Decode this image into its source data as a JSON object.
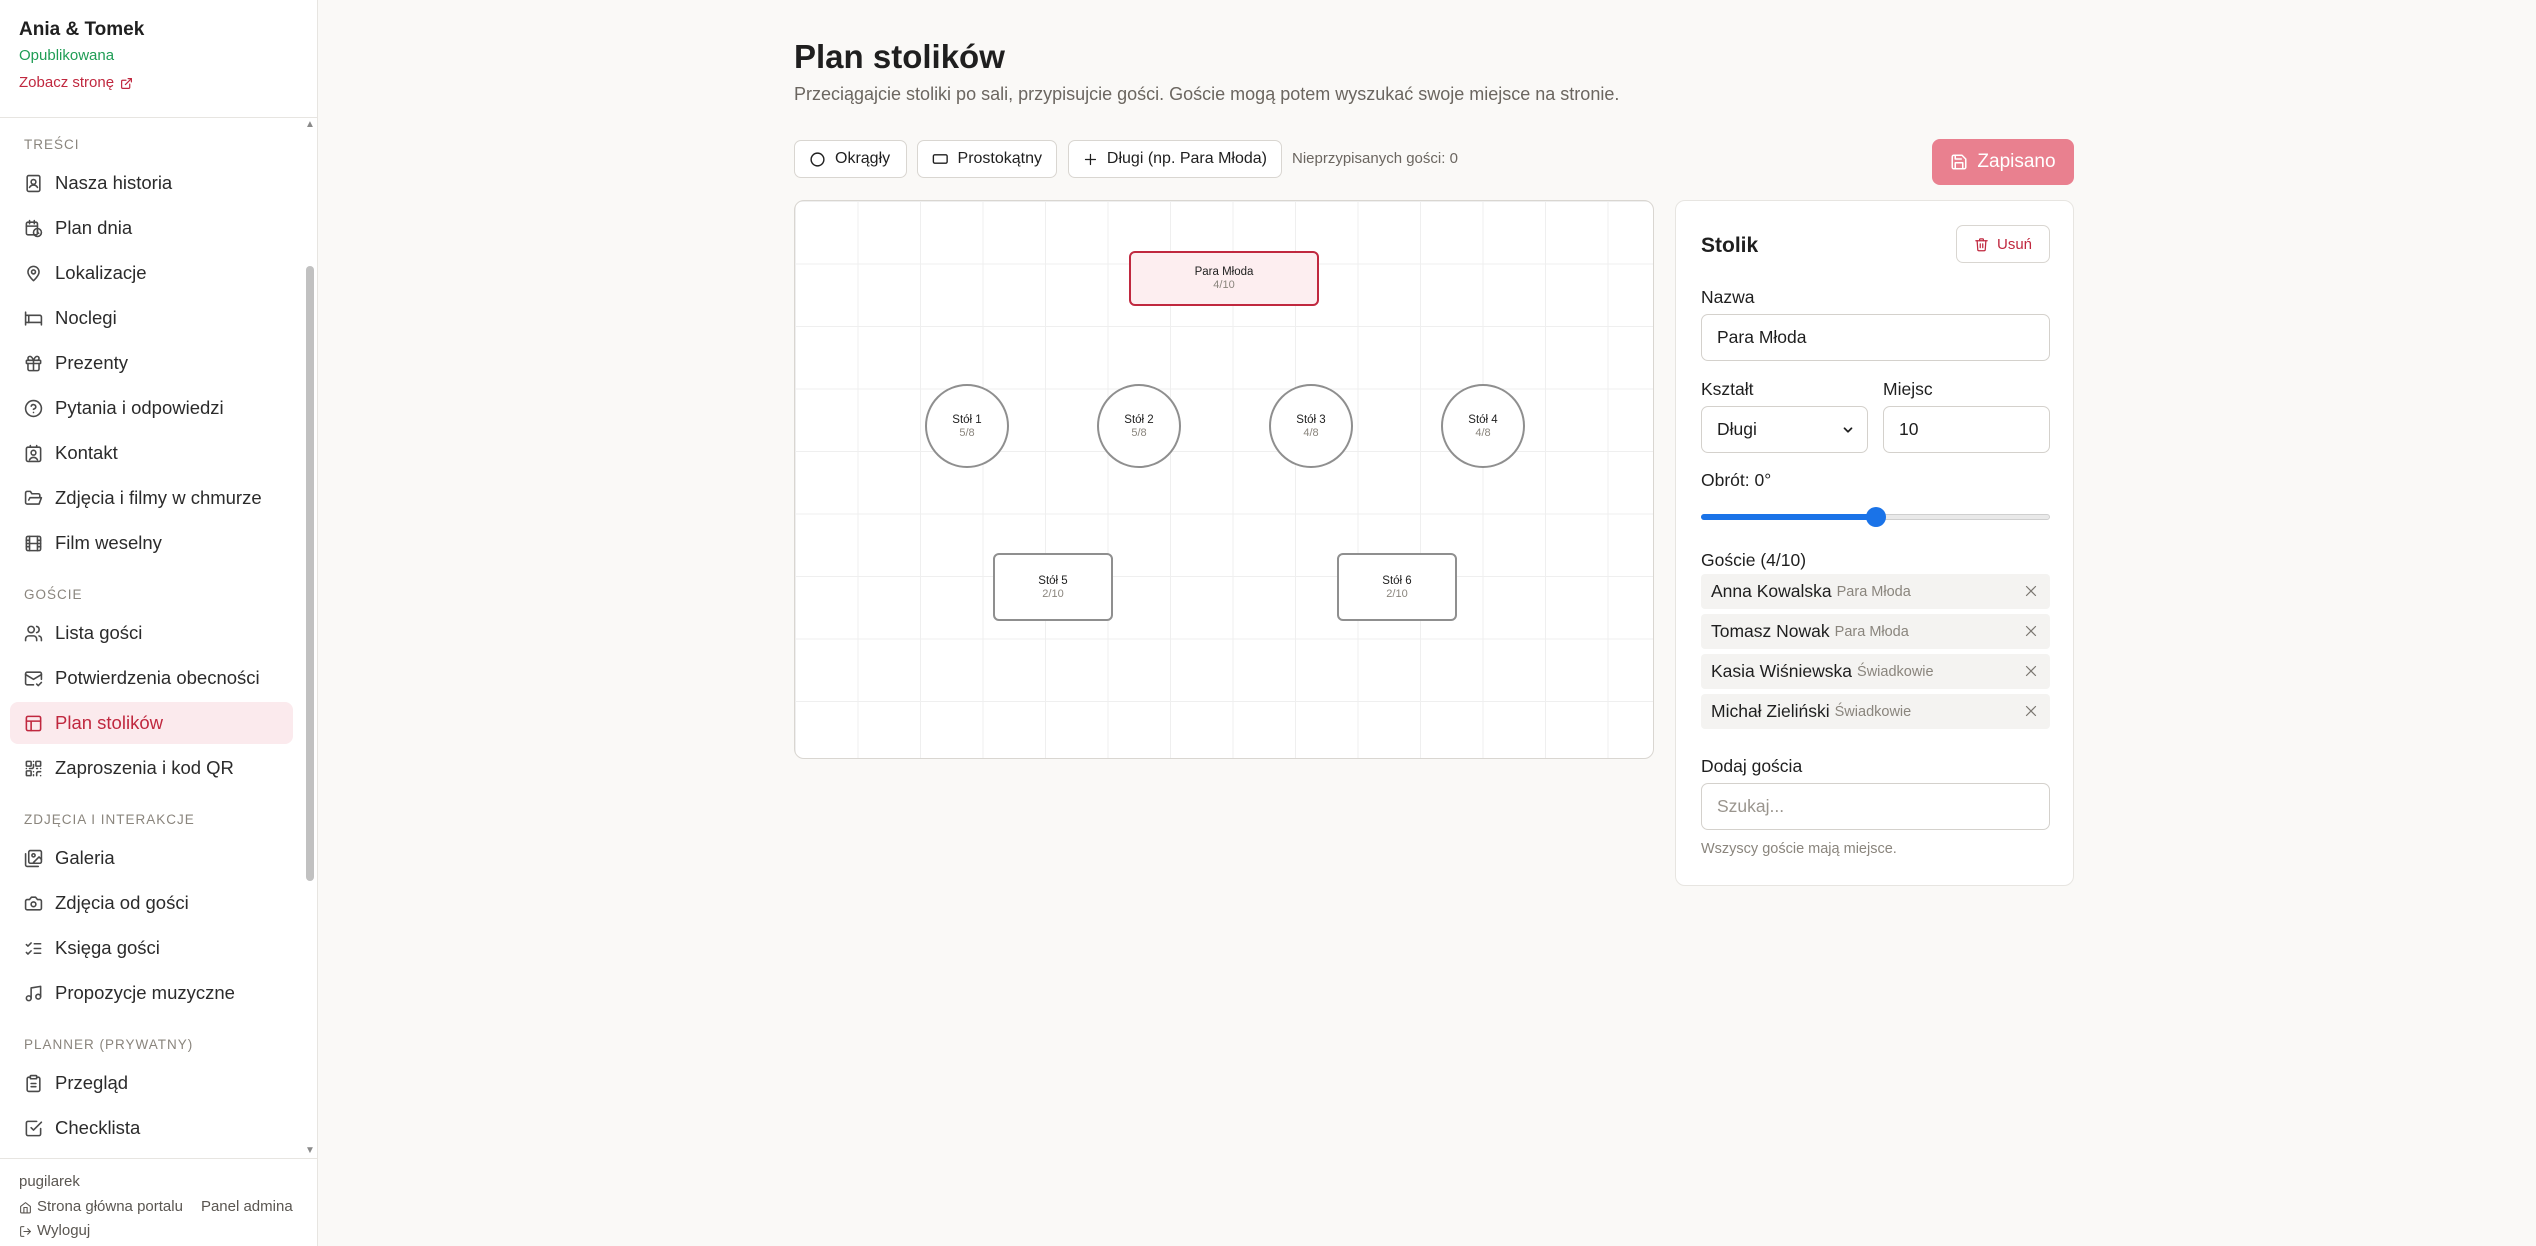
{
  "sidebar": {
    "couple": "Ania & Tomek",
    "status": "Opublikowana",
    "view_link": "Zobacz stronę",
    "sections": [
      {
        "title": "TREŚCI",
        "items": [
          {
            "label": "Nasza historia",
            "icon": "book-user-icon"
          },
          {
            "label": "Plan dnia",
            "icon": "calendar-clock-icon"
          },
          {
            "label": "Lokalizacje",
            "icon": "map-pin-icon"
          },
          {
            "label": "Noclegi",
            "icon": "bed-icon"
          },
          {
            "label": "Prezenty",
            "icon": "gift-icon"
          },
          {
            "label": "Pytania i odpowiedzi",
            "icon": "help-circle-icon"
          },
          {
            "label": "Kontakt",
            "icon": "contact-icon"
          },
          {
            "label": "Zdjęcia i filmy w chmurze",
            "icon": "folder-open-icon"
          },
          {
            "label": "Film weselny",
            "icon": "film-icon"
          }
        ]
      },
      {
        "title": "GOŚCIE",
        "items": [
          {
            "label": "Lista gości",
            "icon": "users-icon"
          },
          {
            "label": "Potwierdzenia obecności",
            "icon": "mail-check-icon"
          },
          {
            "label": "Plan stolików",
            "icon": "layout-grid-icon"
          },
          {
            "label": "Zaproszenia i kod QR",
            "icon": "qr-code-icon"
          }
        ]
      },
      {
        "title": "ZDJĘCIA I INTERAKCJE",
        "items": [
          {
            "label": "Galeria",
            "icon": "images-icon"
          },
          {
            "label": "Zdjęcia od gości",
            "icon": "camera-icon"
          },
          {
            "label": "Księga gości",
            "icon": "list-checks-icon"
          },
          {
            "label": "Propozycje muzyczne",
            "icon": "music-icon"
          }
        ]
      },
      {
        "title": "PLANNER (PRYWATNY)",
        "items": [
          {
            "label": "Przegląd",
            "icon": "clipboard-icon"
          },
          {
            "label": "Checklista",
            "icon": "check-square-icon"
          }
        ]
      }
    ],
    "active_item": "Plan stolików",
    "footer": {
      "user": "pugilarek",
      "home_link": "Strona główna portalu",
      "admin_link": "Panel admina",
      "logout": "Wyloguj"
    }
  },
  "page": {
    "title": "Plan stolików",
    "subtitle": "Przeciągajcie stoliki po sali, przypisujcie gości. Goście mogą potem wyszukać swoje miejsce na stronie."
  },
  "toolbar": {
    "round_label": "Okrągły",
    "rect_label": "Prostokątny",
    "long_label": "Długi (np. Para Młoda)",
    "unassigned": "Nieprzypisanych gości: 0",
    "save_label": "Zapisano"
  },
  "tables": [
    {
      "name": "Para Młoda",
      "count": "4/10",
      "shape": "long",
      "selected": true
    },
    {
      "name": "Stół 1",
      "count": "5/8",
      "shape": "round"
    },
    {
      "name": "Stół 2",
      "count": "5/8",
      "shape": "round"
    },
    {
      "name": "Stół 3",
      "count": "4/8",
      "shape": "round"
    },
    {
      "name": "Stół 4",
      "count": "4/8",
      "shape": "round"
    },
    {
      "name": "Stół 5",
      "count": "2/10",
      "shape": "rect"
    },
    {
      "name": "Stół 6",
      "count": "2/10",
      "shape": "rect"
    }
  ],
  "panel": {
    "title": "Stolik",
    "delete_label": "Usuń",
    "name_label": "Nazwa",
    "name_value": "Para Młoda",
    "shape_label": "Kształt",
    "shape_value": "Długi",
    "seats_label": "Miejsc",
    "seats_value": "10",
    "rotation_label": "Obrót: 0°",
    "rotation_fraction": 0.5,
    "guests_label": "Goście (4/10)",
    "guests": [
      {
        "name": "Anna Kowalska",
        "group": "Para Młoda"
      },
      {
        "name": "Tomasz Nowak",
        "group": "Para Młoda"
      },
      {
        "name": "Kasia Wiśniewska",
        "group": "Świadkowie"
      },
      {
        "name": "Michał Zieliński",
        "group": "Świadkowie"
      }
    ],
    "add_guest_label": "Dodaj gościa",
    "search_placeholder": "Szukaj...",
    "note": "Wszyscy goście mają miejsce."
  },
  "colors": {
    "accent": "#c0283f",
    "published": "#1f9d55",
    "save_button": "#e9808f",
    "slider": "#1a73e8"
  }
}
